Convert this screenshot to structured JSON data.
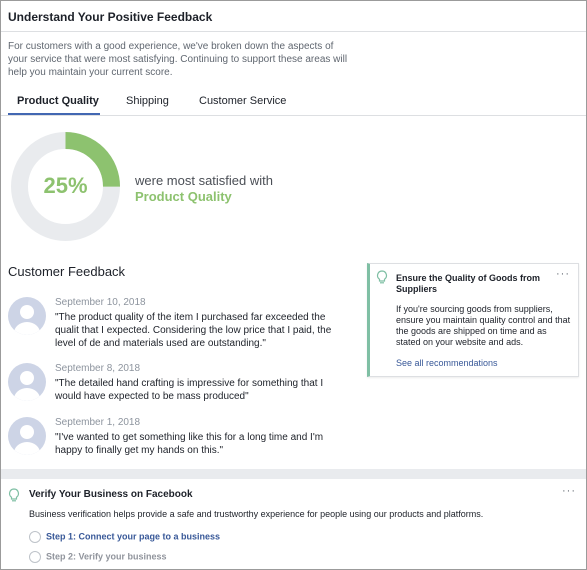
{
  "header": {
    "title": "Understand Your Positive Feedback"
  },
  "intro": "For customers with a good experience, we've broken down the aspects of your service that were most satisfying. Continuing to support these areas will help you maintain your current score.",
  "tabs": [
    {
      "label": "Product Quality",
      "active": true
    },
    {
      "label": "Shipping",
      "active": false
    },
    {
      "label": "Customer Service",
      "active": false
    }
  ],
  "summary": {
    "percent_label": "25%",
    "percent_value": 0.25,
    "line": "were most satisfied with",
    "aspect": "Product Quality",
    "accent_color": "#8dc26f",
    "track_color": "#e9ebee"
  },
  "feedback": {
    "title": "Customer Feedback",
    "items": [
      {
        "date": "September 10, 2018",
        "text": "\"The product quality of the item I purchased far exceeded the qualit that I expected. Considering the low price that I paid, the level of de and materials used are outstanding.\""
      },
      {
        "date": "September 8, 2018",
        "text": "\"The detailed hand crafting is impressive for something that I would have expected to be mass produced\""
      },
      {
        "date": "September 1, 2018",
        "text": "\"I've wanted to get something like this for a long time and I'm happy to finally get my hands on this.\""
      }
    ]
  },
  "recommendation": {
    "icon": "lightbulb-icon",
    "title": "Ensure the Quality of Goods from Suppliers",
    "more": "···",
    "body": "If you're sourcing goods from suppliers, ensure you maintain quality control and that the goods are shipped on time and as stated on your website and ads.",
    "link": "See all recommendations"
  },
  "verify": {
    "icon": "lightbulb-icon",
    "title": "Verify Your Business on Facebook",
    "more": "···",
    "description": "Business verification helps provide a safe and trustworthy experience for people using our products and platforms.",
    "steps": [
      {
        "label": "Step 1: Connect your page to a business"
      },
      {
        "label": "Step 2: Verify your business"
      }
    ]
  }
}
